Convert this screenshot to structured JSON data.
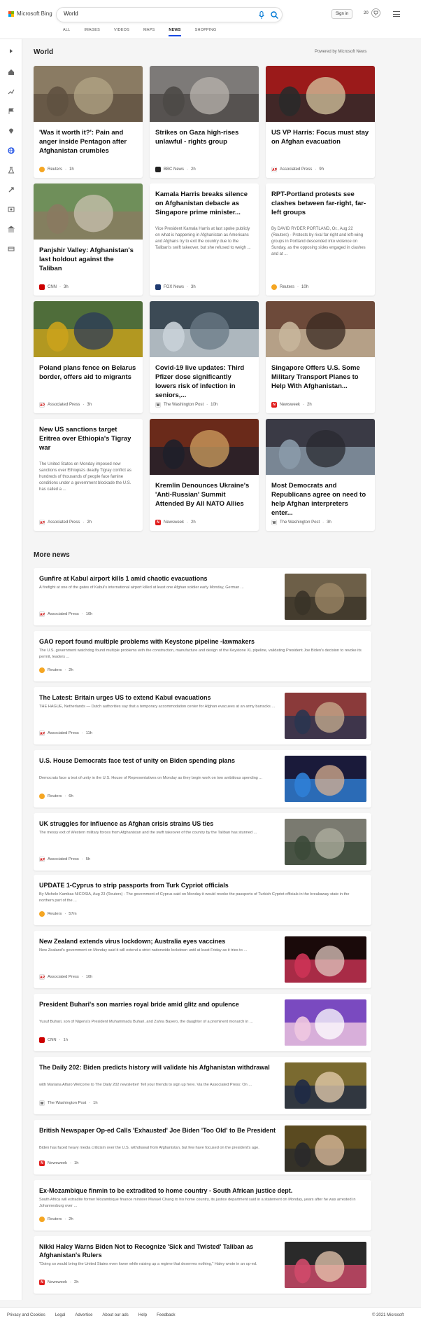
{
  "header": {
    "brand": "Microsoft Bing",
    "search_value": "World",
    "tabs": [
      "ALL",
      "IMAGES",
      "VIDEOS",
      "MAPS",
      "NEWS",
      "SHOPPING"
    ],
    "active_tab": "NEWS",
    "signin": "Sign in",
    "points": "20"
  },
  "world": {
    "title": "World",
    "powered": "Powered by Microsoft News",
    "cards": [
      {
        "title": "'Was it worth it?': Pain and anger inside Pentagon after Afghanistan crumbles",
        "snippet": "",
        "source": "Reuters",
        "age": "1h",
        "logo": "reuters"
      },
      {
        "title": "Strikes on Gaza high-rises unlawful - rights group",
        "snippet": "",
        "source": "BBC News",
        "age": "2h",
        "logo": "bbc"
      },
      {
        "title": "US VP Harris: Focus must stay on Afghan evacuation",
        "snippet": "",
        "source": "Associated Press",
        "age": "9h",
        "logo": "ap"
      },
      {
        "title": "Panjshir Valley: Afghanistan's last holdout against the Taliban",
        "snippet": "",
        "source": "CNN",
        "age": "3h",
        "logo": "cnn"
      },
      {
        "title": "Kamala Harris breaks silence on Afghanistan debacle as Singapore prime minister...",
        "snippet": "Vice President Kamala Harris at last spoke publicly on what is happening in Afghanistan as Americans and Afghans try to exit the country due to the Taliban's swift takeover, but she refused to weigh ...",
        "source": "FOX News",
        "age": "3h",
        "logo": "fox"
      },
      {
        "title": "RPT-Portland protests see clashes between far-right, far-left groups",
        "snippet": "By DAVID RYDER PORTLAND, Or., Aug 22 (Reuters) - Protests by rival far-right and left-wing groups in Portland descended into violence on Sunday, as the opposing sides engaged in clashes and at ...",
        "source": "Reuters",
        "age": "10h",
        "logo": "reuters"
      },
      {
        "title": "Poland plans fence on Belarus border, offers aid to migrants",
        "snippet": "",
        "source": "Associated Press",
        "age": "3h",
        "logo": "ap"
      },
      {
        "title": "Covid-19 live updates: Third Pfizer dose significantly lowers risk of infection in seniors,...",
        "snippet": "",
        "source": "The Washington Post",
        "age": "10h",
        "logo": "wapo"
      },
      {
        "title": "Singapore Offers U.S. Some Military Transport Planes to Help With Afghanistan...",
        "snippet": "",
        "source": "Newsweek",
        "age": "2h",
        "logo": "newsweek"
      },
      {
        "title": "New US sanctions target Eritrea over Ethiopia's Tigray war",
        "snippet": "The United States on Monday imposed new sanctions over Ethiopia's deadly Tigray conflict as hundreds of thousands of people face famine conditions under a government blockade the U.S. has called a ...",
        "source": "Associated Press",
        "age": "2h",
        "logo": "ap"
      },
      {
        "title": "Kremlin Denounces Ukraine's 'Anti-Russian' Summit Attended By All NATO Allies",
        "snippet": "",
        "source": "Newsweek",
        "age": "2h",
        "logo": "newsweek"
      },
      {
        "title": "Most Democrats and Republicans agree on need to help Afghan interpreters enter...",
        "snippet": "",
        "source": "The Washington Post",
        "age": "3h",
        "logo": "wapo"
      }
    ]
  },
  "more": {
    "title": "More news",
    "rows": [
      {
        "title": "Gunfire at Kabul airport kills 1 amid chaotic evacuations",
        "snippet": "A firefight at one of the gates of Kabul's international airport killed at least one Afghan soldier early Monday, German ...",
        "source": "Associated Press",
        "age": "10h",
        "logo": "ap",
        "img": true
      },
      {
        "title": "GAO report found multiple problems with Keystone pipeline -lawmakers",
        "snippet": "The U.S. government watchdog found multiple problems with the construction, manufacture and design of the Keystone XL pipeline, validating President Joe Biden's decision to revoke its permit, leaders ...",
        "source": "Reuters",
        "age": "2h",
        "logo": "reuters",
        "img": false
      },
      {
        "title": "The Latest: Britain urges US to extend Kabul evacuations",
        "snippet": "THE HAGUE, Netherlands — Dutch authorities say that a temporary accommodation center for Afghan evacuees at an army barracks ...",
        "source": "Associated Press",
        "age": "11h",
        "logo": "ap",
        "img": true
      },
      {
        "title": "U.S. House Democrats face test of unity on Biden spending plans",
        "snippet": "Democrats face a test of unity in the U.S. House of Representatives on Monday as they begin work on two ambitious spending ...",
        "source": "Reuters",
        "age": "6h",
        "logo": "reuters",
        "img": true
      },
      {
        "title": "UK struggles for influence as Afghan crisis strains US ties",
        "snippet": "The messy exit of Western military forces from Afghanistan and the swift takeover of the country by the Taliban has stunned ...",
        "source": "Associated Press",
        "age": "5h",
        "logo": "ap",
        "img": true
      },
      {
        "title": "UPDATE 1-Cyprus to strip passports from Turk Cypriot officials",
        "snippet": "By Michele Kambas NICOSIA, Aug 23 (Reuters) - The government of Cyprus said on Monday it would revoke the passports of Turkish Cypriot officials in the breakaway state in the northern part of the ...",
        "source": "Reuters",
        "age": "57m",
        "logo": "reuters",
        "img": false
      },
      {
        "title": "New Zealand extends virus lockdown; Australia eyes vaccines",
        "snippet": "New Zealand's government on Monday said it will extend a strict nationwide lockdown until at least Friday as it tries to ...",
        "source": "Associated Press",
        "age": "10h",
        "logo": "ap",
        "img": true
      },
      {
        "title": "President Buhari's son marries royal bride amid glitz and opulence",
        "snippet": "Yusuf Buhari, son of Nigeria's President Muhammadu Buhari, and Zahra Bayero, the daughter of a prominent monarch in ...",
        "source": "CNN",
        "age": "1h",
        "logo": "cnn",
        "img": true
      },
      {
        "title": "The Daily 202: Biden predicts history will validate his Afghanistan withdrawal",
        "snippet": "with Mariana Alfaro Welcome to The Daily 202 newsletter! Tell your friends to sign up here. Via the Associated Press: On ...",
        "source": "The Washington Post",
        "age": "1h",
        "logo": "wapo",
        "img": true
      },
      {
        "title": "British Newspaper Op-ed Calls 'Exhausted' Joe Biden 'Too Old' to Be President",
        "snippet": "Biden has faced heavy media criticism over the U.S. withdrawal from Afghanistan, but few have focused on the president's age.",
        "source": "Newsweek",
        "age": "1h",
        "logo": "newsweek",
        "img": true
      },
      {
        "title": "Ex-Mozambique finmin to be extradited to home country - South African justice dept.",
        "snippet": "South Africa will extradite former Mozambique finance minister Manuel Chang to his home country, its justice department said in a statement on Monday, years after he was arrested in Johannesburg over ...",
        "source": "Reuters",
        "age": "2h",
        "logo": "reuters",
        "img": false
      },
      {
        "title": "Nikki Haley Warns Biden Not to Recognize 'Sick and Twisted' Taliban as Afghanistan's Rulers",
        "snippet": "\"Doing so would bring the United States even lower while raising up a regime that deserves nothing,\" Haley wrote in an op-ed.",
        "source": "Newsweek",
        "age": "2h",
        "logo": "newsweek",
        "img": true
      }
    ]
  },
  "logos": {
    "reuters": {
      "bg": "#f5a623",
      "text": ""
    },
    "bbc": {
      "bg": "#222222",
      "text": ""
    },
    "ap": {
      "bg": "#ffffff",
      "text": "AP"
    },
    "cnn": {
      "bg": "#cc0000",
      "text": ""
    },
    "fox": {
      "bg": "#1f3a70",
      "text": ""
    },
    "wapo": {
      "bg": "#ffffff",
      "text": "W"
    },
    "newsweek": {
      "bg": "#e01a1a",
      "text": "N"
    }
  },
  "footer": {
    "links": [
      "Privacy and Cookies",
      "Legal",
      "Advertise",
      "About our ads",
      "Help",
      "Feedback"
    ],
    "copyright": "© 2021 Microsoft"
  },
  "colors": {
    "accent": "#174ae4",
    "search_icon": "#0078d4"
  }
}
